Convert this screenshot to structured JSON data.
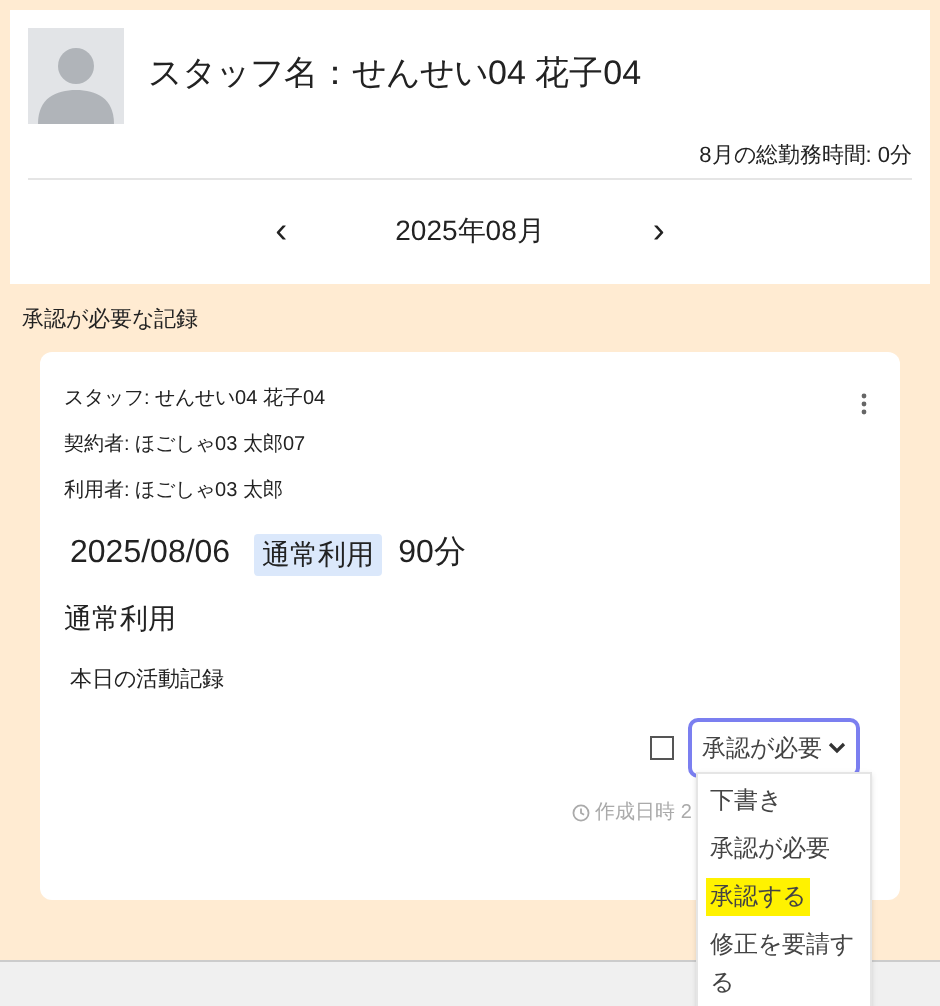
{
  "staff_header": {
    "title": "スタッフ名：せんせい04 花子04",
    "total_hours": "8月の総勤務時間: 0分"
  },
  "month_nav": {
    "prev": "‹",
    "month": "2025年08月",
    "next": "›"
  },
  "section_title": "承認が必要な記録",
  "record": {
    "staff": "スタッフ: せんせい04 花子04",
    "contractor": "契約者: ほごしゃ03 太郎07",
    "user": "利用者: ほごしゃ03 太郎",
    "date": "2025/08/06",
    "tag": "通常利用",
    "duration": "90分",
    "type": "通常利用",
    "note": "本日の活動記録",
    "checked": false,
    "status": "承認が必要",
    "created": "作成日時 2"
  },
  "status_menu": {
    "expanded": true,
    "options": [
      {
        "label": "下書き",
        "highlighted": false
      },
      {
        "label": "承認が必要",
        "highlighted": false
      },
      {
        "label": "承認する",
        "highlighted": true
      },
      {
        "label": "修正を要請する",
        "highlighted": false
      }
    ]
  }
}
